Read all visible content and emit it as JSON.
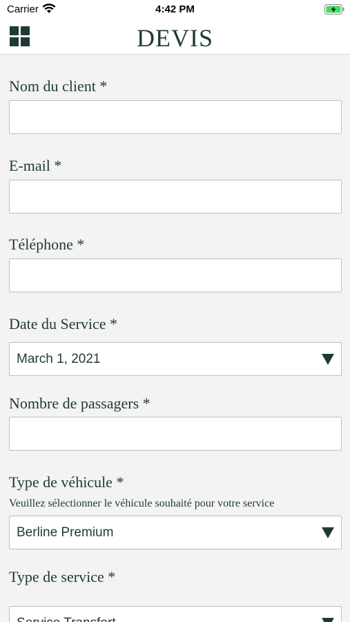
{
  "status_bar": {
    "carrier": "Carrier",
    "time": "4:42 PM"
  },
  "nav": {
    "title": "DEVIS"
  },
  "form": {
    "client_name": {
      "label": "Nom du client *",
      "value": ""
    },
    "email": {
      "label": "E-mail *",
      "value": ""
    },
    "phone": {
      "label": "Téléphone *",
      "value": ""
    },
    "service_date": {
      "label": "Date du Service *",
      "value": "March 1, 2021"
    },
    "passengers": {
      "label": "Nombre de passagers *",
      "value": ""
    },
    "vehicle_type": {
      "label": "Type de véhicule *",
      "help": "Veuillez sélectionner le véhicule souhaité pour votre service",
      "value": "Berline Premium"
    },
    "service_type": {
      "label": "Type de service *",
      "value": "Service Transfert"
    }
  },
  "colors": {
    "text": "#1f3a36",
    "background": "#f3f3f3",
    "input_border": "#b9c0c0",
    "battery_charging": "#4cd964"
  }
}
